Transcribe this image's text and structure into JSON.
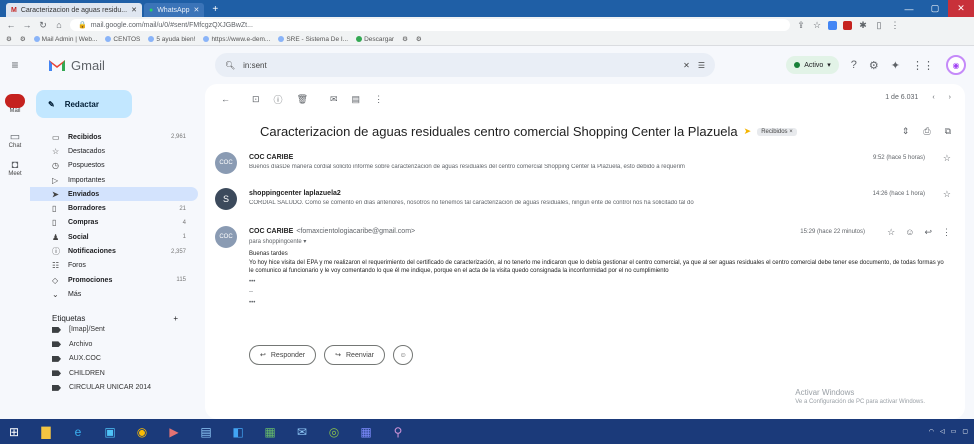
{
  "browser": {
    "tabs": [
      {
        "label": "Caracterizacion de aguas residu...",
        "active": true
      },
      {
        "label": "WhatsApp",
        "active": false
      }
    ],
    "url": "mail.google.com/mail/u/0/#sent/FMfcgzQXJGBwZt...",
    "bookmarks": [
      "Mail Admin | Web...",
      "CENTOS",
      "5 ayuda bien!",
      "https://www.e-dem...",
      "SRE - Sistema De I...",
      "Descargar"
    ]
  },
  "gmail": {
    "logo_text": "Gmail",
    "search_value": "in:sent",
    "status_label": "Activo",
    "compose_label": "Redactar",
    "rail": [
      {
        "icon": "mail-icon",
        "label": "Mail"
      },
      {
        "icon": "chat-icon",
        "label": "Chat"
      },
      {
        "icon": "meet-icon",
        "label": "Meet"
      }
    ],
    "nav": [
      {
        "icon": "▭",
        "label": "Recibidos",
        "count": "2,961",
        "name": "nav-inbox"
      },
      {
        "icon": "☆",
        "label": "Destacados",
        "count": "",
        "name": "nav-starred"
      },
      {
        "icon": "◷",
        "label": "Pospuestos",
        "count": "",
        "name": "nav-snoozed"
      },
      {
        "icon": "▷",
        "label": "Importantes",
        "count": "",
        "name": "nav-important"
      },
      {
        "icon": "➤",
        "label": "Enviados",
        "count": "",
        "name": "nav-sent"
      },
      {
        "icon": "▯",
        "label": "Borradores",
        "count": "21",
        "name": "nav-drafts"
      },
      {
        "icon": "▯",
        "label": "Compras",
        "count": "4",
        "name": "nav-purchases"
      },
      {
        "icon": "♟",
        "label": "Social",
        "count": "1",
        "name": "nav-social"
      },
      {
        "icon": "ⓘ",
        "label": "Notificaciones",
        "count": "2,357",
        "name": "nav-updates"
      },
      {
        "icon": "☷",
        "label": "Foros",
        "count": "",
        "name": "nav-forums"
      },
      {
        "icon": "◇",
        "label": "Promociones",
        "count": "115",
        "name": "nav-promotions"
      },
      {
        "icon": "⌄",
        "label": "Más",
        "count": "",
        "name": "nav-more"
      }
    ],
    "labels_title": "Etiquetas",
    "labels": [
      "[Imap]/Sent",
      "Archivo",
      "AUX.COC",
      "CHILDREN",
      "CIRCULAR UNICAR 2014"
    ],
    "toolbar_right": "1 de 6.031",
    "subject": "Caracterizacion de aguas residuales centro comercial Shopping Center la Plazuela",
    "subject_chip": "Recibidos ×",
    "messages": [
      {
        "sender": "COC CARIBE",
        "snippet": "Buenos díasDe manera cordial solicito informe sobre caracterizacion de aguas residuales del centro comercial Shopping Center la Plazuela, esto debido a requerim",
        "time": "9:52 (hace 5 horas)",
        "avatar_text": "COC",
        "avatar_color": "#8a9bb3"
      },
      {
        "sender": "shoppingcenter laplazuela2",
        "snippet": "CORDIAL SALUDO. Como se comento en días anteriores, nosotros no tenemos tal caracterización de aguas residuales, ningún ente de control nos ha solicitado tal do",
        "time": "14:26 (hace 1 hora)",
        "avatar_text": "S",
        "avatar_color": "#3c4a5c"
      },
      {
        "sender": "COC CARIBE",
        "email": "<fomaxcientologiacaribe@gmail.com>",
        "to_line": "para shoppingcente ▾",
        "time": "15:29 (hace 22 minutos)",
        "avatar_text": "COC",
        "avatar_color": "#8a9bb3",
        "greeting": "Buenas tardes",
        "body": "Yo hoy hice visita del EPA y me realizaron el requerimiento del certificado de caracterización, al no tenerlo me indicaron que lo debía gestionar el centro comercial, ya que al ser aguas residuales el centro comercial debe tener ese documento, de todas formas yo le comunico al funcionario y le voy comentando lo que él me indique, porque en el acta de la visita quedo consignada la inconformidad por el no cumplimiento"
      }
    ],
    "reply_label": "Responder",
    "forward_label": "Reenviar",
    "watermark_title": "Activar Windows",
    "watermark_sub": "Ve a Configuración de PC para activar Windows."
  }
}
